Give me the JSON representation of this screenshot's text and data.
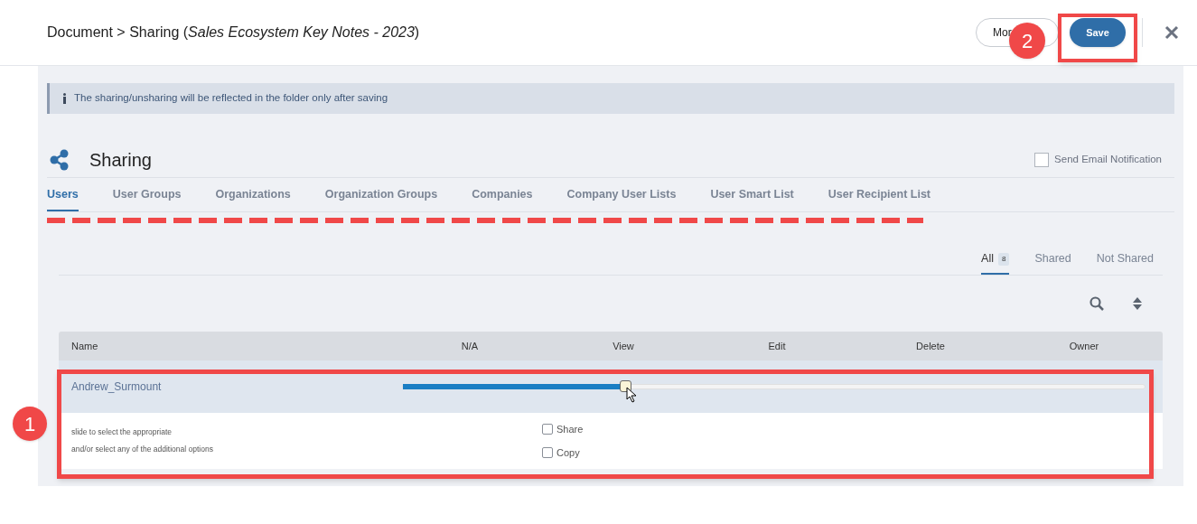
{
  "header": {
    "title": "Document > Sharing (*Sales Ecosystem Key Notes - 2023*)",
    "buttons": [
      {
        "kind": "outline",
        "label": "Mor"
      },
      {
        "kind": "primary",
        "label": "Save"
      }
    ]
  },
  "info": {
    "text": "The sharing/unsharing will be reflected in the folder only after saving"
  },
  "section": {
    "title": "Sharing",
    "send_email": {
      "label": "Send Email Notification",
      "checked": false
    }
  },
  "tabs": [
    {
      "label": "Users",
      "selected": true
    },
    {
      "label": "User Groups",
      "selected": false
    },
    {
      "label": "Organizations",
      "selected": false
    },
    {
      "label": "Organization Groups",
      "selected": false
    },
    {
      "label": "Companies",
      "selected": false
    },
    {
      "label": "Company User Lists",
      "selected": false
    },
    {
      "label": "User Smart List",
      "selected": false
    },
    {
      "label": "User Recipient List",
      "selected": false
    }
  ],
  "filters": [
    {
      "label": "All",
      "count": "8",
      "selected": true
    },
    {
      "label": "Shared",
      "selected": false
    },
    {
      "label": "Not Shared",
      "selected": false
    }
  ],
  "table": {
    "columns": [
      "Name",
      "N/A",
      "View",
      "Edit",
      "Delete",
      "Owner"
    ],
    "rows": [
      {
        "name": "Andrew_Surmount",
        "level": 0.3,
        "hint_lines": [
          "slide to select the appropriate",
          "and/or select any of the additional options"
        ],
        "options": [
          {
            "label": "Share",
            "checked": false
          },
          {
            "label": "Copy",
            "checked": false
          }
        ]
      }
    ]
  },
  "callouts": [
    "1",
    "2"
  ]
}
